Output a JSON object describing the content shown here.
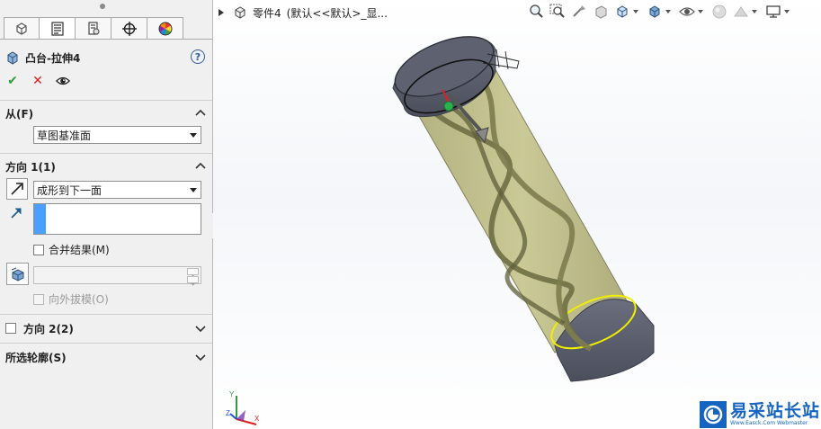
{
  "property_manager": {
    "tabs": [
      {
        "icon": "feature-manager-icon"
      },
      {
        "icon": "property-manager-icon"
      },
      {
        "icon": "configuration-manager-icon"
      },
      {
        "icon": "dimxpert-icon"
      },
      {
        "icon": "display-manager-icon"
      }
    ],
    "feature_title": "凸台-拉伸4",
    "help_label": "?",
    "actions": {
      "ok": "✔",
      "cancel": "✕"
    },
    "from_section": {
      "title": "从(F)",
      "start_condition": "草图基准面"
    },
    "direction1_section": {
      "title": "方向 1(1)",
      "end_condition": "成形到下一面",
      "merge_result_label": "合并结果(M)",
      "merge_result_checked": false,
      "draft_outward_label": "向外拔模(O)",
      "draft_outward_checked": false
    },
    "direction2_section": {
      "title": "方向 2(2)",
      "checked": false
    },
    "selected_contours_section": {
      "title": "所选轮廓(S)"
    }
  },
  "viewport": {
    "breadcrumb": {
      "part_name": "零件4",
      "configuration": "(默认<<默认>_显..."
    },
    "triad": {
      "x": "X",
      "y": "Y",
      "z": "Z"
    },
    "colors": {
      "cylinder_body": "#b5b47a",
      "cap": "#5e6270",
      "selection_edge": "#f2ee00",
      "sweep_path": "#6f6f45"
    }
  },
  "watermark": {
    "title": "易采站长站",
    "subtitle": "Www.Easck.Com Webmaster"
  }
}
